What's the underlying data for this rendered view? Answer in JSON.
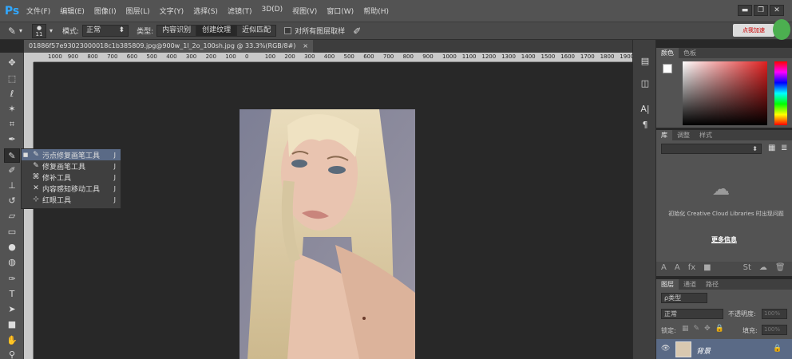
{
  "menubar": {
    "logo": "Ps",
    "items": [
      "文件(F)",
      "编辑(E)",
      "图像(I)",
      "图层(L)",
      "文字(Y)",
      "选择(S)",
      "滤镜(T)",
      "3D(D)",
      "视图(V)",
      "窗口(W)",
      "帮助(H)"
    ],
    "minimize": "▬",
    "restore": "❐",
    "close": "✕"
  },
  "optbar": {
    "brush_size": "11",
    "mode_label": "模式:",
    "mode_value": "正常",
    "type_label": "类型:",
    "type_options": [
      "内容识别",
      "创建纹理",
      "近似匹配"
    ],
    "type_selected": "创建纹理",
    "sample_all_label": "对所有图层取样",
    "badge": "点我加速"
  },
  "document": {
    "tab_title": "01886f57e93023000018c1b385809.jpg@900w_1l_2o_100sh.jpg @ 33.3%(RGB/8#)",
    "close": "×"
  },
  "ruler": {
    "h_ticks": [
      "1000",
      "900",
      "800",
      "700",
      "600",
      "500",
      "400",
      "300",
      "200",
      "100",
      "0",
      "100",
      "200",
      "300",
      "400",
      "500",
      "600",
      "700",
      "800",
      "900",
      "1000",
      "1100",
      "1200",
      "1300",
      "1400",
      "1500",
      "1600",
      "1700",
      "1800",
      "1900"
    ]
  },
  "flyout": {
    "items": [
      {
        "label": "污点修复画笔工具",
        "key": "J",
        "selected": true,
        "icon": "spot-healing-icon",
        "glyph": "✎"
      },
      {
        "label": "修复画笔工具",
        "key": "J",
        "selected": false,
        "icon": "healing-brush-icon",
        "glyph": "✎"
      },
      {
        "label": "修补工具",
        "key": "J",
        "selected": false,
        "icon": "patch-icon",
        "glyph": "⌘"
      },
      {
        "label": "内容感知移动工具",
        "key": "J",
        "selected": false,
        "icon": "content-aware-move-icon",
        "glyph": "✕"
      },
      {
        "label": "红眼工具",
        "key": "J",
        "selected": false,
        "icon": "red-eye-icon",
        "glyph": "⊹"
      }
    ]
  },
  "color_panel": {
    "tabs": [
      "颜色",
      "色板"
    ]
  },
  "library_panel": {
    "tabs": [
      "库",
      "调整",
      "样式"
    ],
    "message": "初始化 Creative Cloud Libraries 时出现问题",
    "more_info": "更多信息"
  },
  "layers_panel": {
    "tabs": [
      "图层",
      "通道",
      "路径"
    ],
    "filter_kind": "ρ类型",
    "blend_mode": "正常",
    "opacity_label": "不透明度:",
    "opacity_value": "100%",
    "lock_label": "锁定:",
    "fill_label": "填充:",
    "fill_value": "100%",
    "layer_name": "背景"
  },
  "colors": {
    "accent": "#5a6a86",
    "ps_blue": "#31a8ff"
  }
}
